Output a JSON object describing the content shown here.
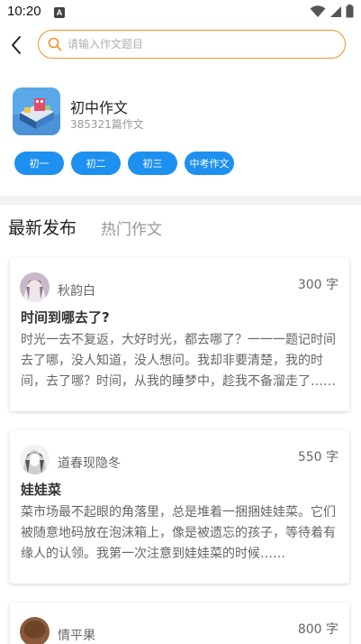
{
  "status_bar": {
    "time": "10:20",
    "badge": "A"
  },
  "search": {
    "placeholder": "请输入作文题目",
    "value": ""
  },
  "category": {
    "title": "初中作文",
    "count_text": "385321篇作文"
  },
  "grades": [
    {
      "label": "初一"
    },
    {
      "label": "初二"
    },
    {
      "label": "初三"
    },
    {
      "label": "中考作文"
    }
  ],
  "tabs": {
    "latest": "最新发布",
    "hot": "热门作文"
  },
  "articles": [
    {
      "author": "秋韵白",
      "word_count": "300 字",
      "title": "时间到哪去了?",
      "excerpt": "时光一去不复返，大好时光，都去哪了？一一一题记时间去了哪，没人知道，没人想问。我却非要清楚，我的时间，去了哪？时间，从我的睡梦中，趁我不备溜走了……"
    },
    {
      "author": "道春现隐冬",
      "word_count": "550 字",
      "title": "娃娃菜",
      "excerpt": "菜市场最不起眼的角落里，总是堆着一捆捆娃娃菜。它们被随意地码放在泡沫箱上，像是被遗忘的孩子，等待着有缘人的认领。我第一次注意到娃娃菜的时候……"
    },
    {
      "author": "情平果",
      "word_count": "800 字",
      "title": "",
      "excerpt": ""
    }
  ],
  "colors": {
    "accent_orange": "#f0922a",
    "button_blue": "#1e90f0"
  }
}
